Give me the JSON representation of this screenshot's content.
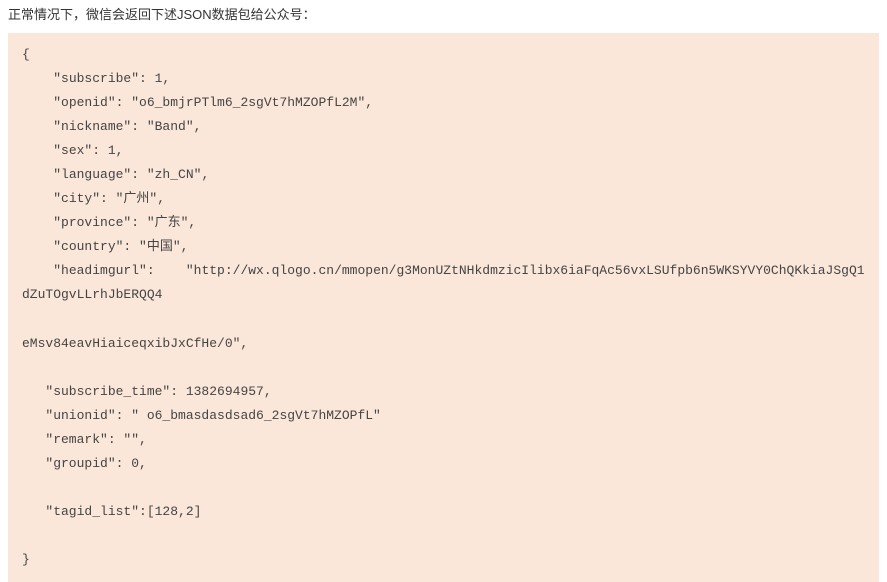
{
  "intro": "正常情况下，微信会返回下述JSON数据包给公众号：",
  "code": "{\n    \"subscribe\": 1, \n    \"openid\": \"o6_bmjrPTlm6_2sgVt7hMZOPfL2M\", \n    \"nickname\": \"Band\", \n    \"sex\": 1, \n    \"language\": \"zh_CN\", \n    \"city\": \"广州\", \n    \"province\": \"广东\", \n    \"country\": \"中国\", \n    \"headimgurl\":    \"http://wx.qlogo.cn/mmopen/g3MonUZtNHkdmzicIlibx6iaFqAc56vxLSUfpb6n5WKSYVY0ChQKkiaJSgQ1dZuTOgvLLrhJbERQQ4\n\neMsv84eavHiaiceqxibJxCfHe/0\",\n\n   \"subscribe_time\": 1382694957,\n   \"unionid\": \" o6_bmasdasdsad6_2sgVt7hMZOPfL\"\n   \"remark\": \"\",\n   \"groupid\": 0,\n\n   \"tagid_list\":[128,2]\n\n}"
}
